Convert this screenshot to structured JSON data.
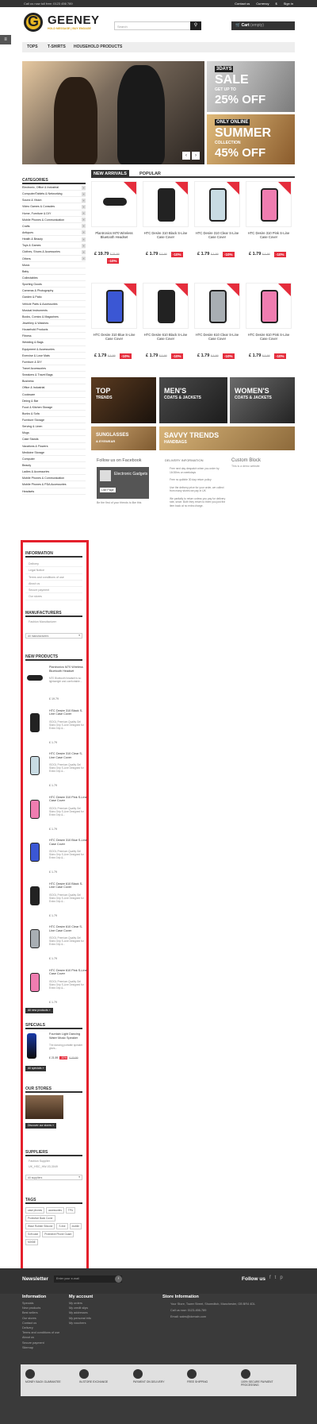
{
  "topbar": {
    "call": "Call us now toll free: 0123 456 789",
    "links": [
      "Contact us",
      "Currency",
      "$",
      "Sign in"
    ]
  },
  "logo": {
    "initial": "G",
    "name": "GEENEY",
    "tagline": "HOLD MESSAGE | BUY ENGAGE"
  },
  "search": {
    "placeholder": "Search",
    "icon": "search-icon"
  },
  "cart": {
    "label": "Cart",
    "count": "(empty)"
  },
  "nav": [
    "TOPS",
    "T-SHIRTS",
    "HOUSEHOLD PRODUCTS"
  ],
  "banners": [
    {
      "l1": "3DAYS",
      "l2": "SALE",
      "l3": "GET UP TO",
      "l4": "25% OFF"
    },
    {
      "l1": "ONLY ONLINE",
      "l2": "SUMMER",
      "l3": "COLLECTION",
      "l4": "45% OFF"
    }
  ],
  "categories": {
    "title": "CATEGORIES",
    "items": [
      "Electronic, Office & Industrial",
      "Computer/Tablets & Networking",
      "Sound & Vision",
      "Video Games & Consoles",
      "Home, Furniture & DIY",
      "Mobile Phones & Communication",
      "Crafts",
      "Antiques",
      "Health & Beauty",
      "Toys & Games",
      "Clothes, Shoes & Accessories",
      "Others",
      "Music",
      "Baby",
      "Collectables",
      "Sporting Goods",
      "Cameras & Photography",
      "Garden & Patio",
      "Vehicle Parts & Accessories",
      "Musical Instruments",
      "Books, Comics & Magazines",
      "Jewellery & Watches",
      "Household Products",
      "Fitness",
      "Wedding & Bags",
      "Equipment & Accessories",
      "Exercise & Lose Mats",
      "Furniture & DIY",
      "Travel Accessories",
      "Sneakers & Travel Bags",
      "Business",
      "Office & Industrial",
      "Cookware",
      "Dining & Bar",
      "Food & Kitchen Storage",
      "Bunks & Sofa",
      "Furniture Storage",
      "Serving & Linen",
      "Mugs",
      "Cake Stands",
      "Vacations & Flowers",
      "Medicine Storage",
      "Computer",
      "Beauty",
      "Ladies & Accessories",
      "Mobile Phones & Communication",
      "Mobile Phones & PDA Accessories",
      "Headsets"
    ]
  },
  "tabs": [
    "NEW ARRIVALS",
    "POPULAR"
  ],
  "products": [
    {
      "name": "Plantronics M70 Wireless Bluetooth Headset",
      "price": "£ 19.79",
      "old": "£ 21.99",
      "disc": "-10%"
    },
    {
      "name": "HTC Desire 310 Black S-Line Case Cover",
      "price": "£ 1.79",
      "old": "£ 1.99",
      "disc": "-10%"
    },
    {
      "name": "HTC Desire 310 Clear S-Line Case Cover",
      "price": "£ 1.79",
      "old": "£ 1.99",
      "disc": "-10%"
    },
    {
      "name": "HTC Desire 310 Pink S-Line Case Cover",
      "price": "£ 1.79",
      "old": "£ 1.99",
      "disc": "-10%"
    },
    {
      "name": "HTC Desire 310 Blue S-Line Case Cover",
      "price": "£ 1.79",
      "old": "£ 1.99",
      "disc": "-10%"
    },
    {
      "name": "HTC Desire 610 Black S-Line Case Cover",
      "price": "£ 1.79",
      "old": "£ 1.99",
      "disc": "-10%"
    },
    {
      "name": "HTC Desire 610 Clear S-Line Case Cover",
      "price": "£ 1.79",
      "old": "£ 1.99",
      "disc": "-10%"
    },
    {
      "name": "HTC Desire 610 Pink S-Line Case Cover",
      "price": "£ 1.79",
      "old": "£ 1.99",
      "disc": "-10%"
    }
  ],
  "tiles": [
    {
      "t1": "TOP",
      "t2": "TRENDS"
    },
    {
      "t1": "MEN'S",
      "t2": "COATS & JACKETS"
    },
    {
      "t1": "WOMEN'S",
      "t2": "COATS & JACKETS"
    },
    {
      "t1": "SUNGLASSES",
      "t2": "& EYEWEAR"
    },
    {
      "t1": "SAVVY TRENDS",
      "t2": "HANDBAGS"
    }
  ],
  "facebook": {
    "title": "Follow us on Facebook",
    "page": "Electronic Gadgets",
    "like": "Like Page",
    "note": "Be the first of your friends to like this"
  },
  "delivery": {
    "title": "DELIVERY INFORMATION",
    "lines": [
      "Free next day despatch when you order by 16:00hrs on weekdays",
      "Free no quibble 30 day return policy",
      "Use the delivery price for your order, we collect from many stores we pay in UK",
      "We partially to return unless you pay for delivery rate, since. Both they return to them you just the item back at no extra charge."
    ]
  },
  "custom": {
    "title": "Custom Block",
    "text": "This is a demo website"
  },
  "information": {
    "title": "INFORMATION",
    "items": [
      "Delivery",
      "Legal Notice",
      "Terms and conditions of use",
      "About us",
      "Secure payment",
      "Our stores"
    ]
  },
  "manufacturers": {
    "title": "MANUFACTURERS",
    "items": [
      "Fashion Manufacturer"
    ],
    "select": "All manufacturers"
  },
  "new_products": {
    "title": "NEW PRODUCTS",
    "items": [
      {
        "title": "Plantronics M70 Wireless Bluetooth Headset",
        "desc": "M70 Bluetooth headset is so lightweight and comfortable...",
        "price": "£ 19.79"
      },
      {
        "title": "HTC Desire 310 Black S-Line Case Cover",
        "desc": "ISOOL Premium Quality Gel Skins Grip S-Line Designed for Extra Grip &...",
        "price": "£ 1.79"
      },
      {
        "title": "HTC Desire 310 Clear S-Line Case Cover",
        "desc": "ISOOL Premium Quality Gel Skins Grip S-Line Designed for Extra Grip &...",
        "price": "£ 1.79"
      },
      {
        "title": "HTC Desire 310 Pink S-Line Case Cover",
        "desc": "ISOOL Premium Quality Gel Skins Grip S-Line Designed for Extra Grip &...",
        "price": "£ 1.79"
      },
      {
        "title": "HTC Desire 310 Blue S-Line Case Cover",
        "desc": "ISOOL Premium Quality Gel Skins Grip S-Line Designed for Extra Grip &...",
        "price": "£ 1.79"
      },
      {
        "title": "HTC Desire 610 Black S-Line Case Cover",
        "desc": "ISOOL Premium Quality Gel Skins Grip S-Line Designed for Extra Grip &...",
        "price": "£ 1.79"
      },
      {
        "title": "HTC Desire 610 Clear S-Line Case Cover",
        "desc": "ISOOL Premium Quality Gel Skins Grip S-Line Designed for Extra Grip &...",
        "price": "£ 1.79"
      },
      {
        "title": "HTC Desire 610 Pink S-Line Case Cover",
        "desc": "ISOOL Premium Quality Gel Skins Grip S-Line Designed for Extra Grip &...",
        "price": "£ 1.79"
      }
    ],
    "all": "All new products »"
  },
  "specials": {
    "title": "SPECIALS",
    "name": "Fountain Light Dancing Water Music Speaker",
    "desc": "The dancing portable speaker gives...",
    "price": "£ 21.59",
    "disc": "-10%",
    "old": "£ 23.99",
    "all": "All specials »"
  },
  "stores": {
    "title": "OUR STORES",
    "btn": "Discover our stores »"
  },
  "suppliers": {
    "title": "SUPPLIERS",
    "items": [
      "Fashion Supplier",
      "UK_HSC_HW-03-3049"
    ],
    "select": "All suppliers"
  },
  "tags": {
    "title": "TAGS",
    "items": [
      "case phones",
      "accessories",
      "TPU",
      "Protective Back Cover",
      "Wave Rubber Silicone",
      "S-line",
      "mobile",
      "Soft case",
      "Protective Phone Guard",
      "MIXBE"
    ]
  },
  "newsletter": {
    "title": "Newsletter",
    "placeholder": "Enter your e-mail",
    "follow": "Follow us"
  },
  "footer": {
    "col1": {
      "title": "Information",
      "items": [
        "Specials",
        "New products",
        "Best sellers",
        "Our stores",
        "Contact us",
        "Delivery",
        "Terms and conditions of use",
        "About us",
        "Secure payment",
        "Sitemap"
      ]
    },
    "col2": {
      "title": "My account",
      "items": [
        "My orders",
        "My credit slips",
        "My addresses",
        "My personal info",
        "My vouchers"
      ]
    },
    "col3": {
      "title": "Store Information",
      "items": [
        "Your Store, Tower Street, Shoreditch, Manchester, GB BR4 4DL",
        "Call us now: 0123-456-789",
        "Email: sales@domain.com"
      ]
    }
  },
  "features": [
    "MONEY BACK GUARANTEE",
    "IN-STORE EXCHANGE",
    "PAYMENT ON DELIVERY",
    "FREE SHIPPING",
    "100% SECURE PAYMENT PROCESSING"
  ],
  "colors": {
    "accent": "#e52d3c",
    "dark": "#333333",
    "gold": "#e9b824",
    "frame": "#e4202c"
  }
}
